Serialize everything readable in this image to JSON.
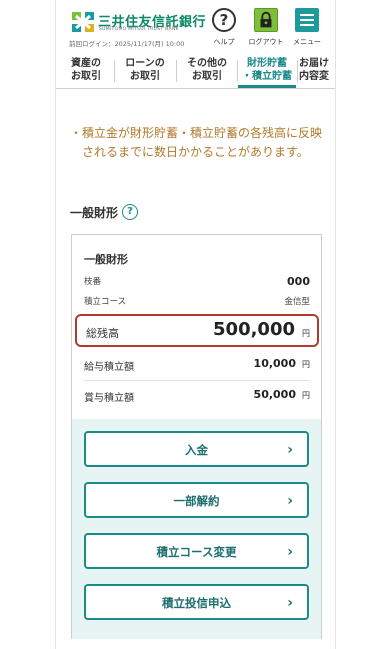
{
  "header": {
    "bank_name": "三井住友信託銀行",
    "bank_sub": "SUMITOMO MITSUI TRUST BANK",
    "last_login": "前回ログイン：2025/11/17(月) 10:00",
    "help_label": "ヘルプ",
    "help_glyph": "?",
    "logout_label": "ログアウト",
    "menu_label": "メニュー"
  },
  "tabs": [
    {
      "line1": "資産の",
      "line2": "お取引"
    },
    {
      "line1": "ローンの",
      "line2": "お取引"
    },
    {
      "line1": "その他の",
      "line2": "お取引"
    },
    {
      "line1": "財形貯蓄",
      "line2": "・積立貯蓄"
    },
    {
      "line1": "お届け",
      "line2": "内容変"
    }
  ],
  "notice": {
    "bullet": "・",
    "text": "積立金が財形貯蓄・積立貯蓄の各残高に反映されるまでに数日かかることがあります。"
  },
  "section": {
    "title": "一般財形",
    "help_glyph": "?"
  },
  "card": {
    "title": "一般財形",
    "branch_label": "枝番",
    "branch_value": "000",
    "course_label": "積立コース",
    "course_value": "金信型",
    "total_label": "総残高",
    "total_value": "500,000",
    "total_unit": "円",
    "salary_label": "給与積立額",
    "salary_value": "10,000",
    "salary_unit": "円",
    "bonus_label": "賞与積立額",
    "bonus_value": "50,000",
    "bonus_unit": "円"
  },
  "actions": [
    {
      "label": "入金"
    },
    {
      "label": "一部解約"
    },
    {
      "label": "積立コース変更"
    },
    {
      "label": "積立投信申込"
    }
  ],
  "colors": {
    "brand": "#0a8a64",
    "accent": "#1d8a8a",
    "notice": "#b07a2a",
    "highlight_border": "#b03a2e"
  }
}
